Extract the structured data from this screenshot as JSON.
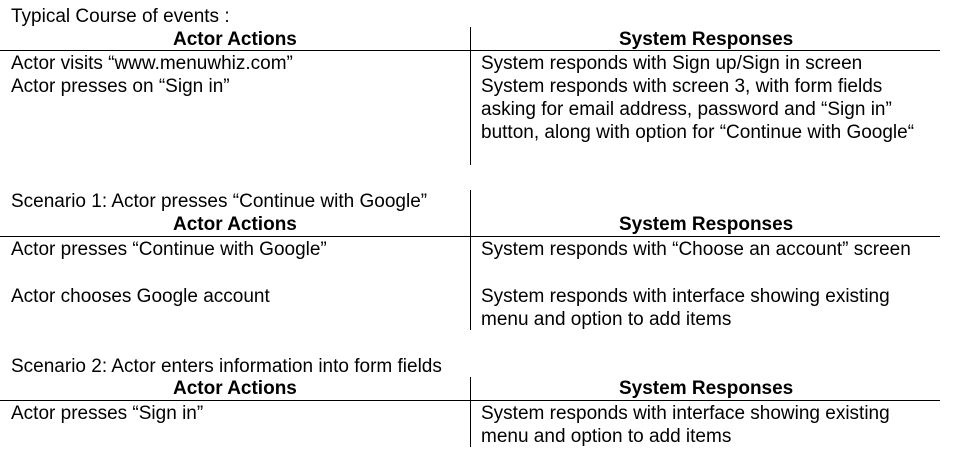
{
  "typical": {
    "title": "Typical Course of events :",
    "header_left": "Actor Actions",
    "header_right": "System Responses",
    "rows": [
      {
        "actor": "Actor visits “www.menuwhiz.com”",
        "system": "System responds with Sign up/Sign in screen"
      },
      {
        "actor": "Actor presses on “Sign in”",
        "system": "System responds with screen 3, with form fields asking for email address, password and “Sign in” button, along with option for “Continue with Google“"
      }
    ]
  },
  "scenario1": {
    "title": "Scenario 1: Actor presses “Continue with Google”",
    "header_left": "Actor Actions",
    "header_right": "System Responses",
    "rows": [
      {
        "actor": "Actor presses “Continue with Google”",
        "system": "System responds with “Choose an account” screen"
      },
      {
        "actor": "Actor chooses Google account",
        "system": "System responds with interface showing existing menu and option to add items"
      }
    ]
  },
  "scenario2": {
    "title": "Scenario 2: Actor enters information into form fields",
    "header_left": "Actor Actions",
    "header_right": "System Responses",
    "rows": [
      {
        "actor": "Actor presses “Sign in”",
        "system": "System responds with interface showing existing menu and option to add items"
      }
    ]
  }
}
